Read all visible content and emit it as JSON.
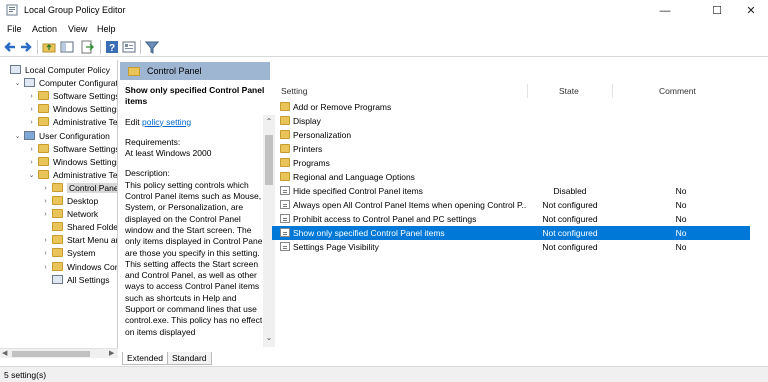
{
  "window": {
    "title": "Local Group Policy Editor",
    "minimize": "—",
    "maximize": "☐",
    "close": "✕"
  },
  "menu": [
    "File",
    "Action",
    "View",
    "Help"
  ],
  "tree": [
    {
      "label": "Local Computer Policy",
      "level": 0,
      "expander": "",
      "icon": "policy-icon"
    },
    {
      "label": "Computer Configurati",
      "level": 1,
      "expander": "⌄",
      "icon": "computer-icon"
    },
    {
      "label": "Software Settings",
      "level": 2,
      "expander": "›",
      "icon": "folder-icon"
    },
    {
      "label": "Windows Settings",
      "level": 2,
      "expander": "›",
      "icon": "folder-icon"
    },
    {
      "label": "Administrative Te",
      "level": 2,
      "expander": "›",
      "icon": "folder-icon"
    },
    {
      "label": "User Configuration",
      "level": 1,
      "expander": "⌄",
      "icon": "user-icon"
    },
    {
      "label": "Software Settings",
      "level": 2,
      "expander": "›",
      "icon": "folder-icon"
    },
    {
      "label": "Windows Settings",
      "level": 2,
      "expander": "›",
      "icon": "folder-icon"
    },
    {
      "label": "Administrative Te",
      "level": 2,
      "expander": "⌄",
      "icon": "folder-icon"
    },
    {
      "label": "Control Panel",
      "level": 3,
      "expander": "›",
      "icon": "folder-icon",
      "selected": true
    },
    {
      "label": "Desktop",
      "level": 3,
      "expander": "›",
      "icon": "folder-icon"
    },
    {
      "label": "Network",
      "level": 3,
      "expander": "›",
      "icon": "folder-icon"
    },
    {
      "label": "Shared Folder",
      "level": 3,
      "expander": "",
      "icon": "folder-icon"
    },
    {
      "label": "Start Menu ar",
      "level": 3,
      "expander": "›",
      "icon": "folder-icon"
    },
    {
      "label": "System",
      "level": 3,
      "expander": "›",
      "icon": "folder-icon"
    },
    {
      "label": "Windows Con",
      "level": 3,
      "expander": "›",
      "icon": "folder-icon"
    },
    {
      "label": "All Settings",
      "level": 3,
      "expander": "",
      "icon": "settings-icon"
    }
  ],
  "header": {
    "label": "Control Panel"
  },
  "description": {
    "title": "Show only specified Control Panel items",
    "edit_prefix": "Edit ",
    "edit_link": "policy setting",
    "requirements_label": "Requirements:",
    "requirements_value": "At least Windows 2000",
    "description_label": "Description:",
    "description_text": "This policy setting controls which Control Panel items such as Mouse, System, or Personalization, are displayed on the Control Panel window and the Start screen. The only items displayed in Control Panel are those you specify in this setting. This setting affects the Start screen and Control Panel, as well as other ways to access Control Panel items such as shortcuts in Help and Support or command lines that use control.exe. This policy has no effect on items displayed"
  },
  "tabs": [
    "Extended",
    "Standard"
  ],
  "columns": {
    "setting": "Setting",
    "state": "State",
    "comment": "Comment"
  },
  "rows": [
    {
      "name": "Add or Remove Programs",
      "state": "",
      "comment": "",
      "type": "folder"
    },
    {
      "name": "Display",
      "state": "",
      "comment": "",
      "type": "folder"
    },
    {
      "name": "Personalization",
      "state": "",
      "comment": "",
      "type": "folder"
    },
    {
      "name": "Printers",
      "state": "",
      "comment": "",
      "type": "folder"
    },
    {
      "name": "Programs",
      "state": "",
      "comment": "",
      "type": "folder"
    },
    {
      "name": "Regional and Language Options",
      "state": "",
      "comment": "",
      "type": "folder"
    },
    {
      "name": "Hide specified Control Panel items",
      "state": "Disabled",
      "comment": "No",
      "type": "setting"
    },
    {
      "name": "Always open All Control Panel Items when opening Control P...",
      "state": "Not configured",
      "comment": "No",
      "type": "setting"
    },
    {
      "name": "Prohibit access to Control Panel and PC settings",
      "state": "Not configured",
      "comment": "No",
      "type": "setting"
    },
    {
      "name": "Show only specified Control Panel items",
      "state": "Not configured",
      "comment": "No",
      "type": "setting",
      "selected": true
    },
    {
      "name": "Settings Page Visibility",
      "state": "Not configured",
      "comment": "No",
      "type": "setting"
    }
  ],
  "status": {
    "text": "5 setting(s)"
  },
  "colors": {
    "selection": "#0078d7",
    "header_band": "#9fb6d3",
    "link": "#0066cc"
  }
}
